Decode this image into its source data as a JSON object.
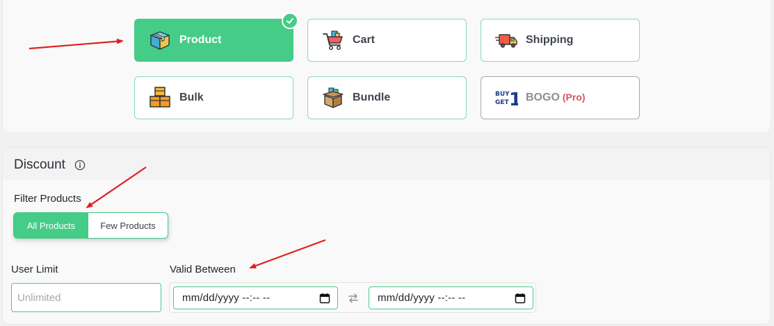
{
  "discount_types": [
    {
      "label": "Product",
      "icon": "product-box-icon",
      "selected": true
    },
    {
      "label": "Cart",
      "icon": "shopping-cart-icon",
      "selected": false
    },
    {
      "label": "Shipping",
      "icon": "delivery-truck-icon",
      "selected": false
    },
    {
      "label": "Bulk",
      "icon": "stacked-boxes-icon",
      "selected": false
    },
    {
      "label": "Bundle",
      "icon": "open-box-bundle-icon",
      "selected": false
    },
    {
      "label": "BOGO",
      "pro_tag": "(Pro)",
      "icon": "buy-get-one-icon",
      "selected": false
    }
  ],
  "discount": {
    "title": "Discount",
    "filter_products": {
      "label": "Filter Products",
      "options": [
        "All Products",
        "Few Products"
      ],
      "selected": "All Products"
    },
    "user_limit": {
      "label": "User Limit",
      "placeholder": "Unlimited"
    },
    "valid_between": {
      "label": "Valid Between",
      "start_value": "mm/dd/yyyy --:-- --",
      "end_value": "mm/dd/yyyy --:-- --"
    }
  },
  "colors": {
    "accent": "#45cc87",
    "pro": "#d4555f",
    "annotation_arrow": "#e02020"
  }
}
